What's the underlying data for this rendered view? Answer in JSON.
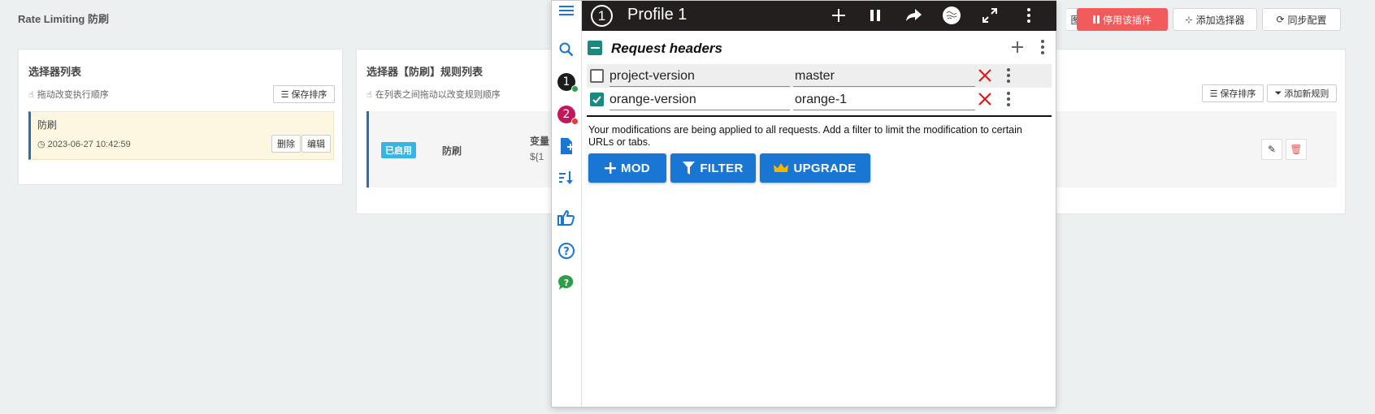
{
  "app": {
    "page_title": "Rate Limiting 防刷",
    "top_actions": {
      "partial_label": "图",
      "disable_plugin": "停用该插件",
      "add_selector": "添加选择器",
      "sync_config": "同步配置"
    },
    "selector_panel": {
      "title": "选择器列表",
      "hint": "拖动改变执行顺序",
      "save_order": "保存排序",
      "item": {
        "name": "防刷",
        "timestamp": "2023-06-27 10:42:59",
        "delete": "删除",
        "edit": "编辑"
      }
    },
    "rule_panel": {
      "title": "选择器【防刷】规则列表",
      "hint": "在列表之间拖动以改变规则顺序",
      "save_order": "保存排序",
      "add_rule": "添加新规则",
      "row": {
        "status": "已启用",
        "name": "防刷",
        "var_partial": "变量",
        "expr_partial": "${1"
      }
    }
  },
  "popup": {
    "profile_title": "Profile 1",
    "profile_number": "1",
    "sidebar": {
      "profiles": [
        {
          "number": "1",
          "color": "#1c1c1c",
          "dot": "#2e9e4a"
        },
        {
          "number": "2",
          "color": "#c2185b",
          "dot": "#e53935"
        }
      ]
    },
    "section_title": "Request headers",
    "headers": [
      {
        "name": "project-version",
        "value": "master",
        "enabled": false
      },
      {
        "name": "orange-version",
        "value": "orange-1",
        "enabled": true
      }
    ],
    "notice": "Your modifications are being applied to all requests. Add a filter to limit the modification to certain URLs or tabs.",
    "buttons": {
      "mod": "MOD",
      "filter": "FILTER",
      "upgrade": "UPGRADE"
    },
    "colors": {
      "topbar": "#231f1f",
      "primary_button": "#1976d2",
      "delete_x": "#e01b1b",
      "checkbox_checked": "#1a8a80",
      "crown": "#f5b400"
    }
  }
}
